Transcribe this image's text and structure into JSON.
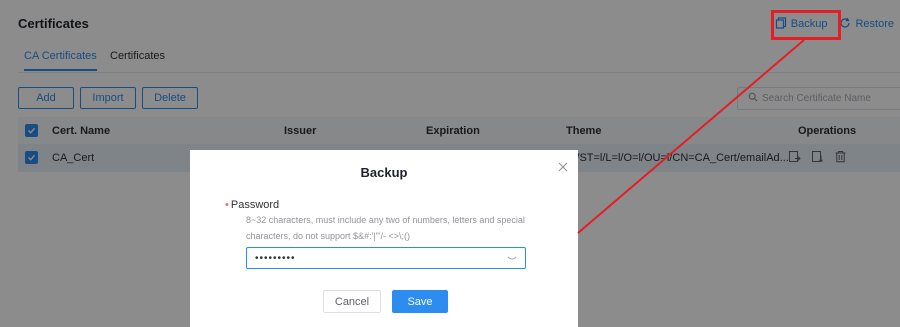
{
  "header": {
    "title": "Certificates",
    "backup_label": "Backup",
    "restore_label": "Restore"
  },
  "tabs": [
    {
      "label": "CA Certificates",
      "active": true
    },
    {
      "label": "Certificates",
      "active": false
    }
  ],
  "toolbar": {
    "add_label": "Add",
    "import_label": "Import",
    "delete_label": "Delete",
    "search_placeholder": "Search Certificate Name"
  },
  "table": {
    "columns": [
      "Cert. Name",
      "Issuer",
      "Expiration",
      "Theme",
      "Operations"
    ],
    "rows": [
      {
        "name": "CA_Cert",
        "theme": "/S/ST=l/L=l/O=l/OU=l/CN=CA_Cert/emailAd...",
        "checked": true
      }
    ]
  },
  "modal": {
    "title": "Backup",
    "password_label": "Password",
    "password_hint_line1": "8~32 characters, must include any two of numbers, letters and special",
    "password_hint_line2": "characters, do not support $&#:'|\"'/- <>\\;()",
    "password_value": "•••••••••",
    "cancel_label": "Cancel",
    "save_label": "Save"
  },
  "colors": {
    "accent": "#2d8cf0",
    "highlight": "#e31e24",
    "required": "#f56c6c"
  },
  "icons": [
    "backup-icon",
    "restore-icon",
    "search-icon",
    "checkbox-checked-icon",
    "export-icon",
    "download-icon",
    "trash-icon",
    "close-icon",
    "eye-icon"
  ]
}
